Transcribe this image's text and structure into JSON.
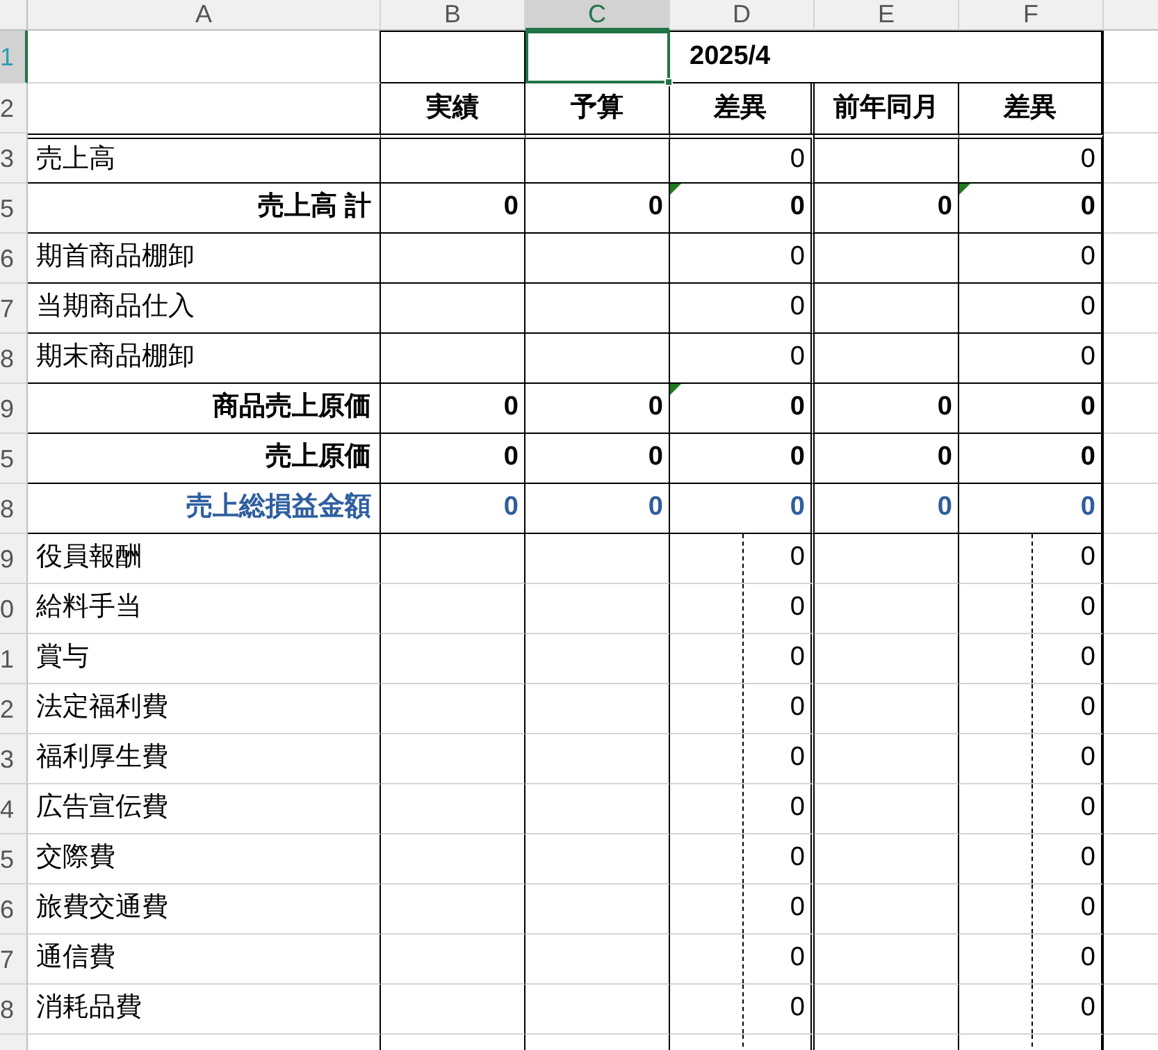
{
  "column_headers": [
    {
      "label": "A",
      "selected": false
    },
    {
      "label": "B",
      "selected": false
    },
    {
      "label": "C",
      "selected": true
    },
    {
      "label": "D",
      "selected": false
    },
    {
      "label": "E",
      "selected": false
    },
    {
      "label": "F",
      "selected": false
    }
  ],
  "title_row": {
    "row": "1",
    "selected": true,
    "period": "2025/4"
  },
  "header_row": {
    "row": "2",
    "labels": [
      "実績",
      "予算",
      "差異",
      "前年同月",
      "差異"
    ]
  },
  "rows": [
    {
      "row": "3",
      "kind": "item",
      "label": "売上高",
      "cells": [
        {
          "flagged": false
        },
        {
          "flagged": false
        },
        {
          "value": "0",
          "flagged": false
        },
        {
          "flagged": false
        },
        {
          "value": "0",
          "flagged": false
        }
      ]
    },
    {
      "row": "5",
      "kind": "total",
      "label": "売上高 計",
      "cells": [
        {
          "value": "0",
          "flagged": false
        },
        {
          "value": "0",
          "flagged": false
        },
        {
          "value": "0",
          "flagged": true
        },
        {
          "value": "0",
          "flagged": false
        },
        {
          "value": "0",
          "flagged": true
        }
      ]
    },
    {
      "row": "6",
      "kind": "item",
      "label": "期首商品棚卸",
      "cells": [
        {
          "flagged": false
        },
        {
          "flagged": false
        },
        {
          "value": "0",
          "flagged": false
        },
        {
          "flagged": false
        },
        {
          "value": "0",
          "flagged": false
        }
      ]
    },
    {
      "row": "7",
      "kind": "item",
      "label": "当期商品仕入",
      "cells": [
        {
          "flagged": false
        },
        {
          "flagged": false
        },
        {
          "value": "0",
          "flagged": false
        },
        {
          "flagged": false
        },
        {
          "value": "0",
          "flagged": false
        }
      ]
    },
    {
      "row": "8",
      "kind": "item",
      "label": "期末商品棚卸",
      "cells": [
        {
          "flagged": false
        },
        {
          "flagged": false
        },
        {
          "value": "0",
          "flagged": false
        },
        {
          "flagged": false
        },
        {
          "value": "0",
          "flagged": false
        }
      ]
    },
    {
      "row": "9",
      "kind": "total",
      "label": "商品売上原価",
      "cells": [
        {
          "value": "0",
          "flagged": false
        },
        {
          "value": "0",
          "flagged": false
        },
        {
          "value": "0",
          "flagged": true
        },
        {
          "value": "0",
          "flagged": false
        },
        {
          "value": "0",
          "flagged": false
        }
      ]
    },
    {
      "row": "5",
      "kind": "total",
      "label": "売上原価",
      "cells": [
        {
          "value": "0",
          "flagged": false
        },
        {
          "value": "0",
          "flagged": false
        },
        {
          "value": "0",
          "flagged": false
        },
        {
          "value": "0",
          "flagged": false
        },
        {
          "value": "0",
          "flagged": false
        }
      ]
    },
    {
      "row": "8",
      "kind": "gross",
      "label": "売上総損益金額",
      "cells": [
        {
          "value": "0",
          "flagged": false
        },
        {
          "value": "0",
          "flagged": false
        },
        {
          "value": "0",
          "flagged": false
        },
        {
          "value": "0",
          "flagged": false
        },
        {
          "value": "0",
          "flagged": false
        }
      ]
    },
    {
      "row": "9",
      "kind": "expense",
      "label": "役員報酬",
      "cells": [
        {
          "flagged": false
        },
        {
          "flagged": false
        },
        {
          "value": "0",
          "flagged": false
        },
        {
          "flagged": false
        },
        {
          "value": "0",
          "flagged": false
        }
      ]
    },
    {
      "row": "0",
      "kind": "expense",
      "label": "給料手当",
      "cells": [
        {
          "flagged": false
        },
        {
          "flagged": false
        },
        {
          "value": "0",
          "flagged": false
        },
        {
          "flagged": false
        },
        {
          "value": "0",
          "flagged": false
        }
      ]
    },
    {
      "row": "1",
      "kind": "expense",
      "label": "賞与",
      "cells": [
        {
          "flagged": false
        },
        {
          "flagged": false
        },
        {
          "value": "0",
          "flagged": false
        },
        {
          "flagged": false
        },
        {
          "value": "0",
          "flagged": false
        }
      ]
    },
    {
      "row": "2",
      "kind": "expense",
      "label": "法定福利費",
      "cells": [
        {
          "flagged": false
        },
        {
          "flagged": false
        },
        {
          "value": "0",
          "flagged": false
        },
        {
          "flagged": false
        },
        {
          "value": "0",
          "flagged": false
        }
      ]
    },
    {
      "row": "3",
      "kind": "expense",
      "label": "福利厚生費",
      "cells": [
        {
          "flagged": false
        },
        {
          "flagged": false
        },
        {
          "value": "0",
          "flagged": false
        },
        {
          "flagged": false
        },
        {
          "value": "0",
          "flagged": false
        }
      ]
    },
    {
      "row": "4",
      "kind": "expense",
      "label": "広告宣伝費",
      "cells": [
        {
          "flagged": false
        },
        {
          "flagged": false
        },
        {
          "value": "0",
          "flagged": false
        },
        {
          "flagged": false
        },
        {
          "value": "0",
          "flagged": false
        }
      ]
    },
    {
      "row": "5",
      "kind": "expense",
      "label": "交際費",
      "cells": [
        {
          "flagged": false
        },
        {
          "flagged": false
        },
        {
          "value": "0",
          "flagged": false
        },
        {
          "flagged": false
        },
        {
          "value": "0",
          "flagged": false
        }
      ]
    },
    {
      "row": "6",
      "kind": "expense",
      "label": "旅費交通費",
      "cells": [
        {
          "flagged": false
        },
        {
          "flagged": false
        },
        {
          "value": "0",
          "flagged": false
        },
        {
          "flagged": false
        },
        {
          "value": "0",
          "flagged": false
        }
      ]
    },
    {
      "row": "7",
      "kind": "expense",
      "label": "通信費",
      "cells": [
        {
          "flagged": false
        },
        {
          "flagged": false
        },
        {
          "value": "0",
          "flagged": false
        },
        {
          "flagged": false
        },
        {
          "value": "0",
          "flagged": false
        }
      ]
    },
    {
      "row": "8",
      "kind": "expense",
      "label": "消耗品費",
      "cells": [
        {
          "flagged": false
        },
        {
          "flagged": false
        },
        {
          "value": "0",
          "flagged": false
        },
        {
          "flagged": false
        },
        {
          "value": "0",
          "flagged": false
        }
      ]
    }
  ]
}
